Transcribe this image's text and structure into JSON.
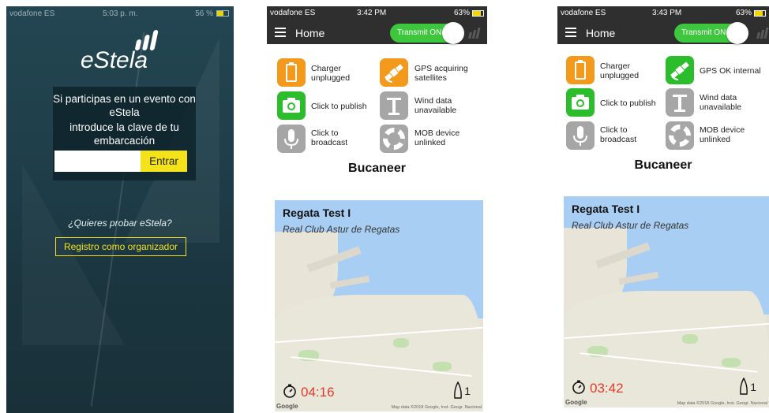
{
  "login": {
    "status": {
      "carrier": "vodafone ES",
      "time": "5:03 p. m.",
      "battery": "56 %"
    },
    "logo": "eStela",
    "prompt_line1": "Si participas en un evento con eStela",
    "prompt_line2": "introduce la clave de tu embarcación",
    "code_input_value": "",
    "enter_button": "Entrar",
    "try_text": "¿Quieres probar eStela?",
    "register_button": "Registro como organizador",
    "colors": {
      "accent": "#f4e21a",
      "background": "#1f3f4a"
    }
  },
  "screens": [
    {
      "status": {
        "carrier": "vodafone ES",
        "time": "3:42 PM",
        "battery": "63%"
      },
      "title": "Home",
      "transmit_toggle": "Transmit ON",
      "tiles": [
        {
          "icon": "battery-icon",
          "label": "Charger unplugged",
          "color": "#f39a1d"
        },
        {
          "icon": "satellite-icon",
          "label": "GPS acquiring satellites",
          "color": "#f39a1d"
        },
        {
          "icon": "camera-icon",
          "label": "Click to publish",
          "color": "#2bbd2b"
        },
        {
          "icon": "wind-sensor-icon",
          "label": "Wind data unavailable",
          "color": "#a6a6a6"
        },
        {
          "icon": "microphone-icon",
          "label": "Click to broadcast",
          "color": "#a6a6a6"
        },
        {
          "icon": "lifebuoy-icon",
          "label": "MOB device unlinked",
          "color": "#a6a6a6"
        }
      ],
      "boat_name": "Bucaneer",
      "event": {
        "title": "Regata Test I",
        "club": "Real Club Astur de Regatas",
        "timer": "04:16",
        "boats": "1",
        "map_brand": "Google",
        "map_attribution": "Map data ©2018 Google, Inst. Geogr. Nacional"
      }
    },
    {
      "status": {
        "carrier": "vodafone ES",
        "time": "3:43 PM",
        "battery": "63%"
      },
      "title": "Home",
      "transmit_toggle": "Transmit ON",
      "tiles": [
        {
          "icon": "battery-icon",
          "label": "Charger unplugged",
          "color": "#f39a1d"
        },
        {
          "icon": "satellite-icon",
          "label": "GPS OK internal",
          "color": "#2bbd2b"
        },
        {
          "icon": "camera-icon",
          "label": "Click to publish",
          "color": "#2bbd2b"
        },
        {
          "icon": "wind-sensor-icon",
          "label": "Wind data unavailable",
          "color": "#a6a6a6"
        },
        {
          "icon": "microphone-icon",
          "label": "Click to broadcast",
          "color": "#a6a6a6"
        },
        {
          "icon": "lifebuoy-icon",
          "label": "MOB device unlinked",
          "color": "#a6a6a6"
        }
      ],
      "boat_name": "Bucaneer",
      "event": {
        "title": "Regata Test I",
        "club": "Real Club Astur de Regatas",
        "timer": "03:42",
        "boats": "1",
        "map_brand": "Google",
        "map_attribution": "Map data ©2018 Google, Inst. Geogr. Nacional"
      }
    }
  ]
}
